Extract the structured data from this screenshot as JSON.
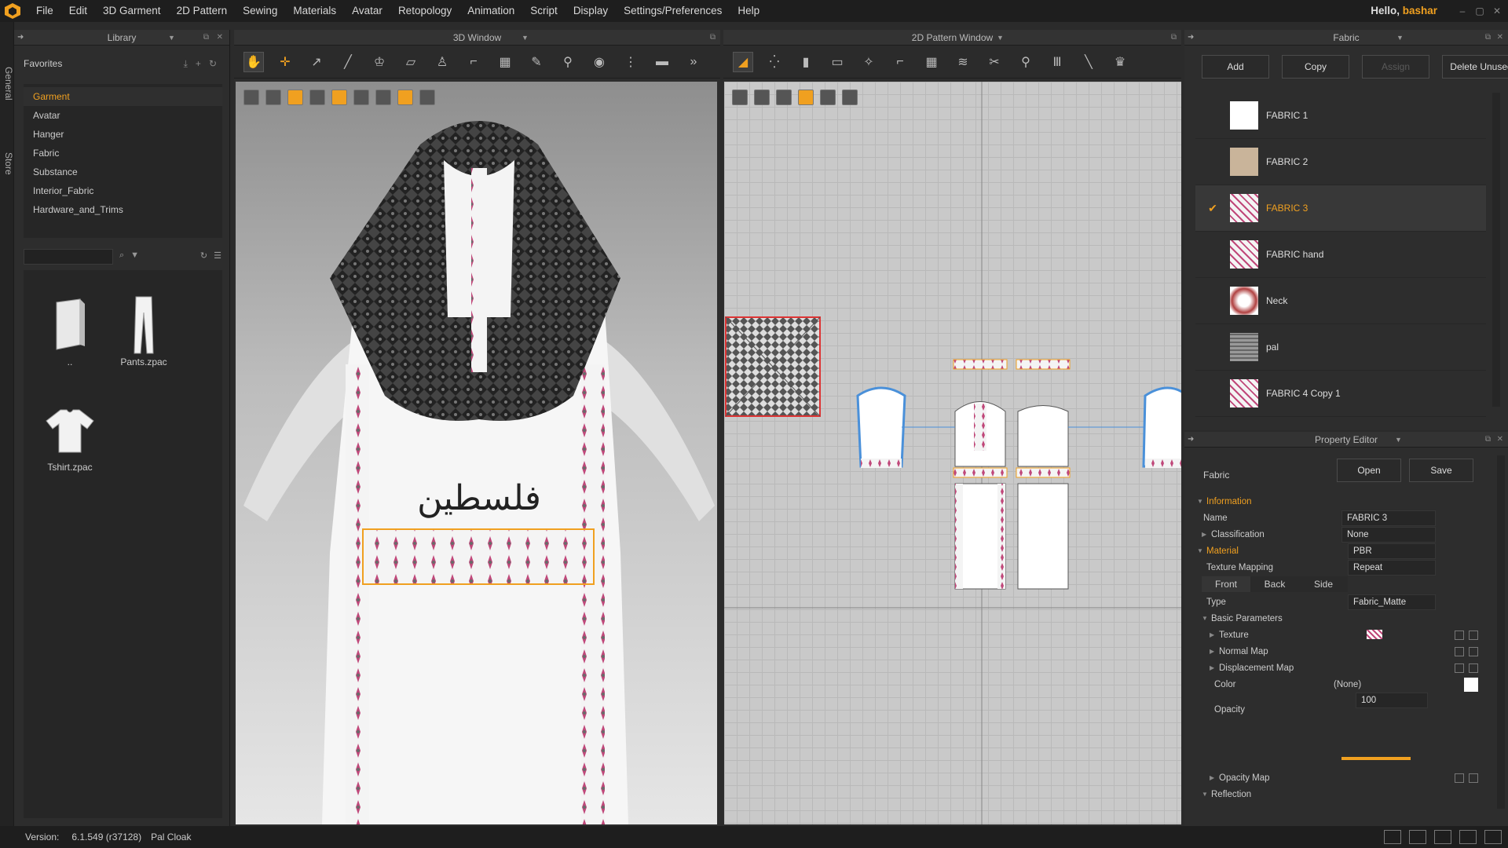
{
  "menubar": {
    "items": [
      "File",
      "Edit",
      "3D Garment",
      "2D Pattern",
      "Sewing",
      "Materials",
      "Avatar",
      "Retopology",
      "Animation",
      "Script",
      "Display",
      "Settings/Preferences",
      "Help"
    ],
    "greeting": "Hello, ",
    "user": "bashar"
  },
  "sidetabs": [
    "General",
    "Store"
  ],
  "library": {
    "title": "Library",
    "favorites_label": "Favorites",
    "favorites": [
      "Garment",
      "Avatar",
      "Hanger",
      "Fabric",
      "Substance",
      "Interior_Fabric",
      "Hardware_and_Trims"
    ],
    "active_favorite": "Garment",
    "files": [
      {
        "label": "..",
        "icon": "folder-up-icon"
      },
      {
        "label": "Pants.zpac",
        "icon": "pants-icon"
      },
      {
        "label": "Tshirt.zpac",
        "icon": "tshirt-icon"
      }
    ]
  },
  "window3d": {
    "title": "3D Window"
  },
  "window2d": {
    "title": "2D Pattern Window"
  },
  "fabric_panel": {
    "title": "Fabric",
    "buttons": {
      "add": "Add",
      "copy": "Copy",
      "assign": "Assign",
      "delete_unused": "Delete Unused"
    },
    "items": [
      {
        "name": "FABRIC 1",
        "swatch": "#ffffff",
        "selected": false
      },
      {
        "name": "FABRIC 2",
        "swatch": "#c9b49a",
        "selected": false
      },
      {
        "name": "FABRIC 3",
        "swatch": "pattern",
        "selected": true
      },
      {
        "name": "FABRIC hand",
        "swatch": "pattern",
        "selected": false
      },
      {
        "name": "Neck",
        "swatch": "neck",
        "selected": false
      },
      {
        "name": "pal",
        "swatch": "grey",
        "selected": false
      },
      {
        "name": "FABRIC 4 Copy 1",
        "swatch": "pattern",
        "selected": false
      }
    ]
  },
  "property_editor": {
    "title": "Property Editor",
    "object_label": "Fabric",
    "open": "Open",
    "save": "Save",
    "information": "Information",
    "name_label": "Name",
    "name_value": "FABRIC 3",
    "classification_label": "Classification",
    "classification_value": "None",
    "material": "Material",
    "material_value": "PBR",
    "texture_mapping_label": "Texture Mapping",
    "texture_mapping_value": "Repeat",
    "tabs": [
      "Front",
      "Back",
      "Side"
    ],
    "type_label": "Type",
    "type_value": "Fabric_Matte",
    "basic_parameters": "Basic Parameters",
    "texture": "Texture",
    "normal_map": "Normal Map",
    "displacement_map": "Displacement Map",
    "color_label": "Color",
    "color_value": "(None)",
    "opacity_label": "Opacity",
    "opacity_value": "100",
    "opacity_map": "Opacity Map",
    "reflection": "Reflection"
  },
  "statusbar": {
    "version_label": "Version:",
    "version": "6.1.549 (r37128)",
    "file": "Pal Cloak"
  },
  "colors": {
    "accent": "#f0a020",
    "bg": "#2d2d2d",
    "pattern_outline": "#4a90d9"
  }
}
